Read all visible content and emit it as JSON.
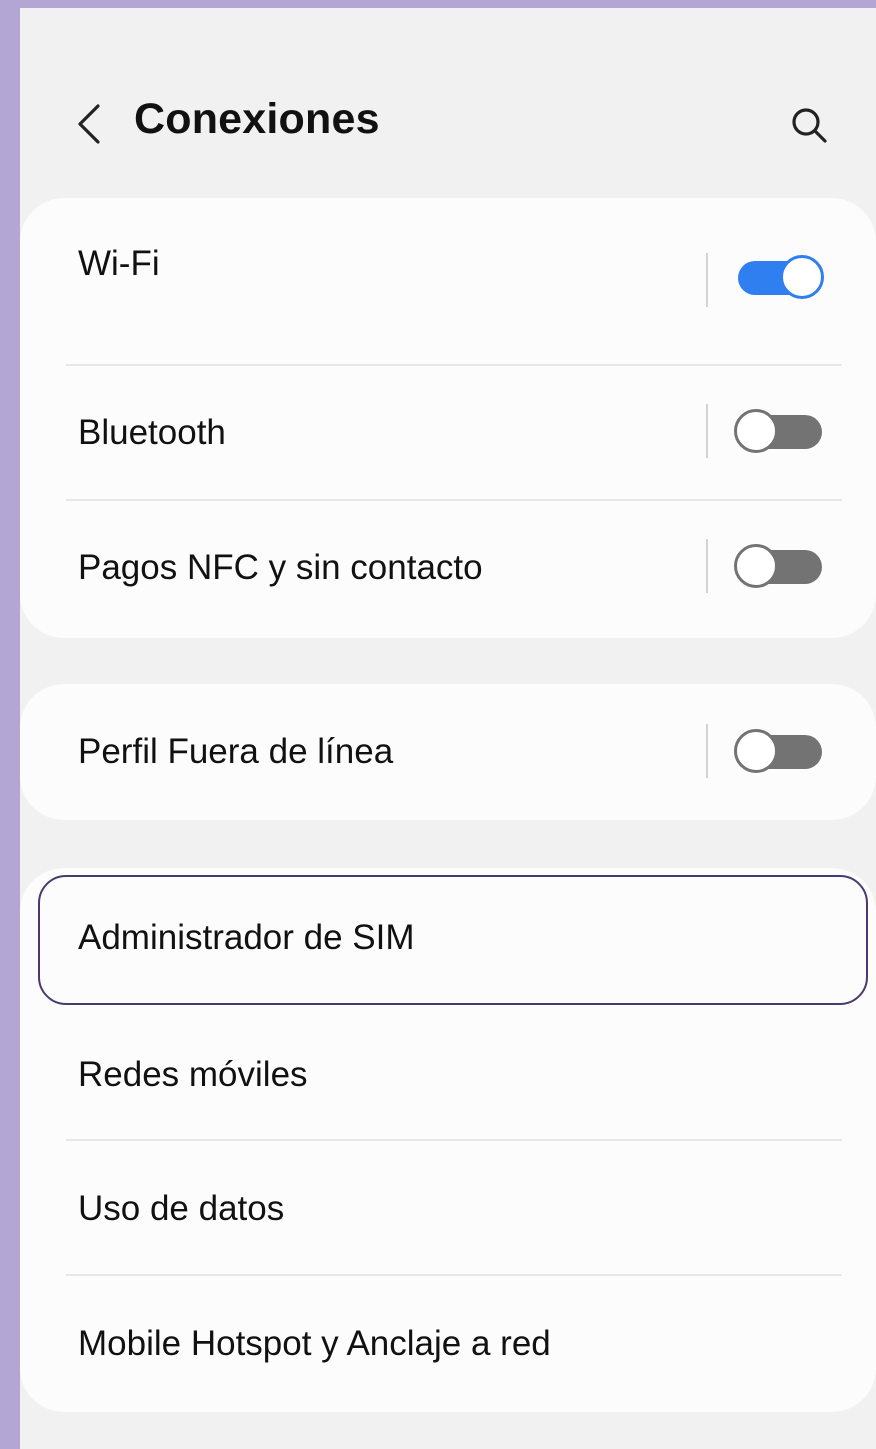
{
  "header": {
    "title": "Conexiones",
    "back_icon": "chevron-left-icon",
    "search_icon": "search-icon"
  },
  "group1": {
    "items": [
      {
        "label": "Wi-Fi",
        "toggle": "on"
      },
      {
        "label": "Bluetooth",
        "toggle": "off"
      },
      {
        "label": "Pagos NFC y sin contacto",
        "toggle": "off"
      }
    ]
  },
  "group2": {
    "items": [
      {
        "label": "Perfil Fuera de línea",
        "toggle": "off"
      }
    ]
  },
  "group3": {
    "items": [
      {
        "label": "Administrador de SIM"
      },
      {
        "label": "Redes móviles"
      },
      {
        "label": "Uso de datos"
      },
      {
        "label": "Mobile Hotspot y Anclaje a red"
      }
    ]
  },
  "colors": {
    "background": "#f1f1f1",
    "card": "#fcfcfc",
    "accent": "#2f7ff0",
    "toggle_off": "#737373",
    "highlight_border": "#4a3a6e",
    "frame": "#b4a6d4"
  }
}
